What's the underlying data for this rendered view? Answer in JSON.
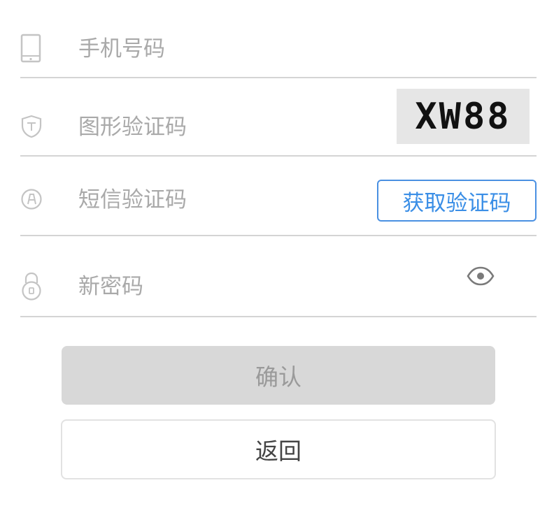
{
  "form": {
    "phone": {
      "placeholder": "手机号码",
      "value": "",
      "icon": "phone-icon"
    },
    "captcha": {
      "placeholder": "图形验证码",
      "value": "",
      "icon": "shield-icon",
      "image_text": "XW88"
    },
    "sms": {
      "placeholder": "短信验证码",
      "value": "",
      "icon": "sms-code-icon",
      "button_label": "获取验证码"
    },
    "password": {
      "placeholder": "新密码",
      "value": "",
      "icon": "lock-icon",
      "toggle_icon": "eye-icon"
    }
  },
  "actions": {
    "confirm_label": "确认",
    "back_label": "返回"
  },
  "colors": {
    "accent": "#3a8ee6",
    "divider": "#d4d4d4",
    "placeholder": "#a9a9a9",
    "confirm_bg_disabled": "#d8d8d8",
    "captcha_bg": "#e6e6e6"
  }
}
